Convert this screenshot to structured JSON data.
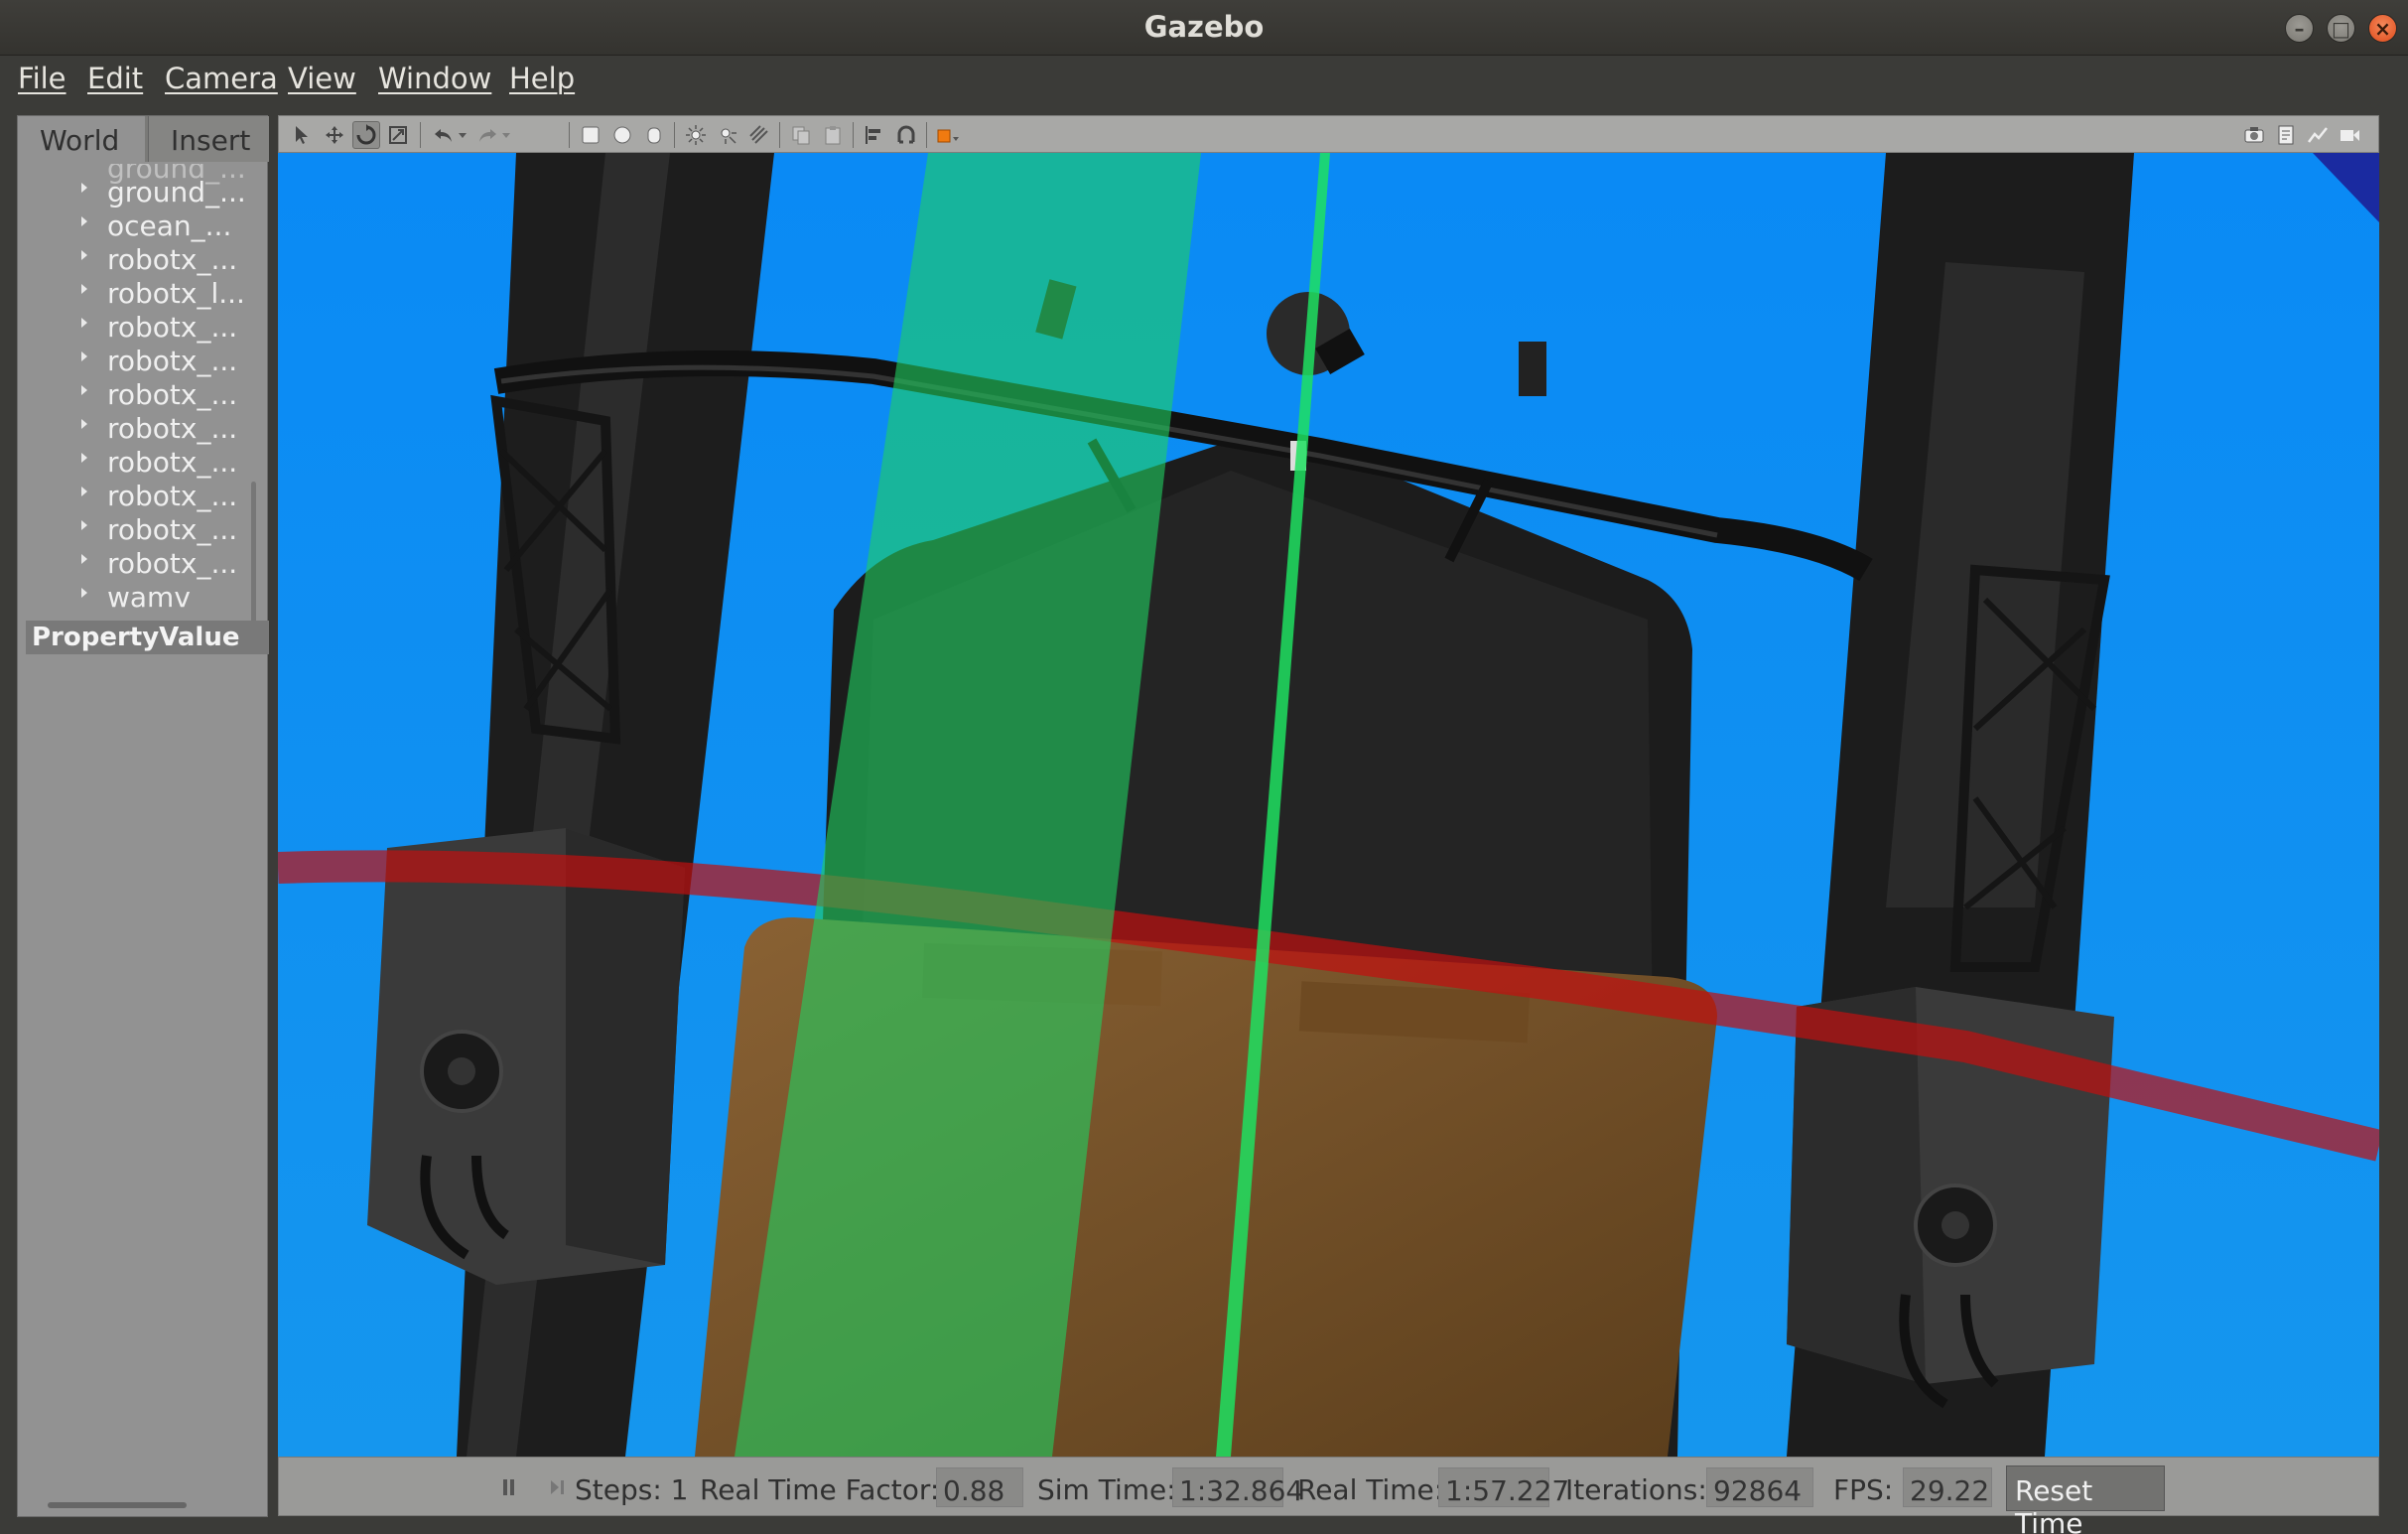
{
  "window": {
    "title": "Gazebo"
  },
  "menu": [
    {
      "label": "File"
    },
    {
      "label": "Edit"
    },
    {
      "label": "Camera"
    },
    {
      "label": "View"
    },
    {
      "label": "Window"
    },
    {
      "label": "Help"
    }
  ],
  "left_panel": {
    "tabs": [
      {
        "label": "World"
      },
      {
        "label": "Insert"
      }
    ],
    "tree_items": [
      {
        "label": "ground_..."
      },
      {
        "label": "ocean_..."
      },
      {
        "label": "robotx_..."
      },
      {
        "label": "robotx_l..."
      },
      {
        "label": "robotx_..."
      },
      {
        "label": "robotx_..."
      },
      {
        "label": "robotx_..."
      },
      {
        "label": "robotx_..."
      },
      {
        "label": "robotx_..."
      },
      {
        "label": "robotx_..."
      },
      {
        "label": "robotx_..."
      },
      {
        "label": "robotx_..."
      },
      {
        "label": "wamv"
      }
    ],
    "property_header": "PropertyValue"
  },
  "toolbar": {
    "icons": [
      "select-arrow-icon",
      "translate-icon",
      "rotate-icon",
      "scale-icon",
      "undo-icon",
      "undo-dropdown-icon",
      "redo-icon",
      "redo-dropdown-icon",
      "box-icon",
      "sphere-icon",
      "cylinder-icon",
      "point-light-icon",
      "spot-light-icon",
      "directional-light-icon",
      "copy-icon",
      "paste-icon",
      "align-icon",
      "snap-icon",
      "view-angle-icon"
    ],
    "right_icons": [
      "screenshot-icon",
      "log-icon",
      "plot-icon",
      "video-record-icon"
    ],
    "active": "rotate-icon"
  },
  "status": {
    "steps_label": "Steps: 1",
    "rtf_label": "Real Time Factor:",
    "rtf_value": "0.88",
    "sim_time_label": "Sim Time:",
    "sim_time_value": "1:32.864",
    "real_time_label": "Real Time:",
    "real_time_value": "1:57.227",
    "iterations_label": "Iterations:",
    "iterations_value": "92864",
    "fps_label": "FPS:",
    "fps_value": "29.22",
    "reset_label": "Reset Time"
  },
  "colors": {
    "sky": "#1c8ff0",
    "panel": "#929292",
    "selection_green": "#20c060",
    "axis_red": "#c01010",
    "case_brown": "#6b4a22"
  }
}
